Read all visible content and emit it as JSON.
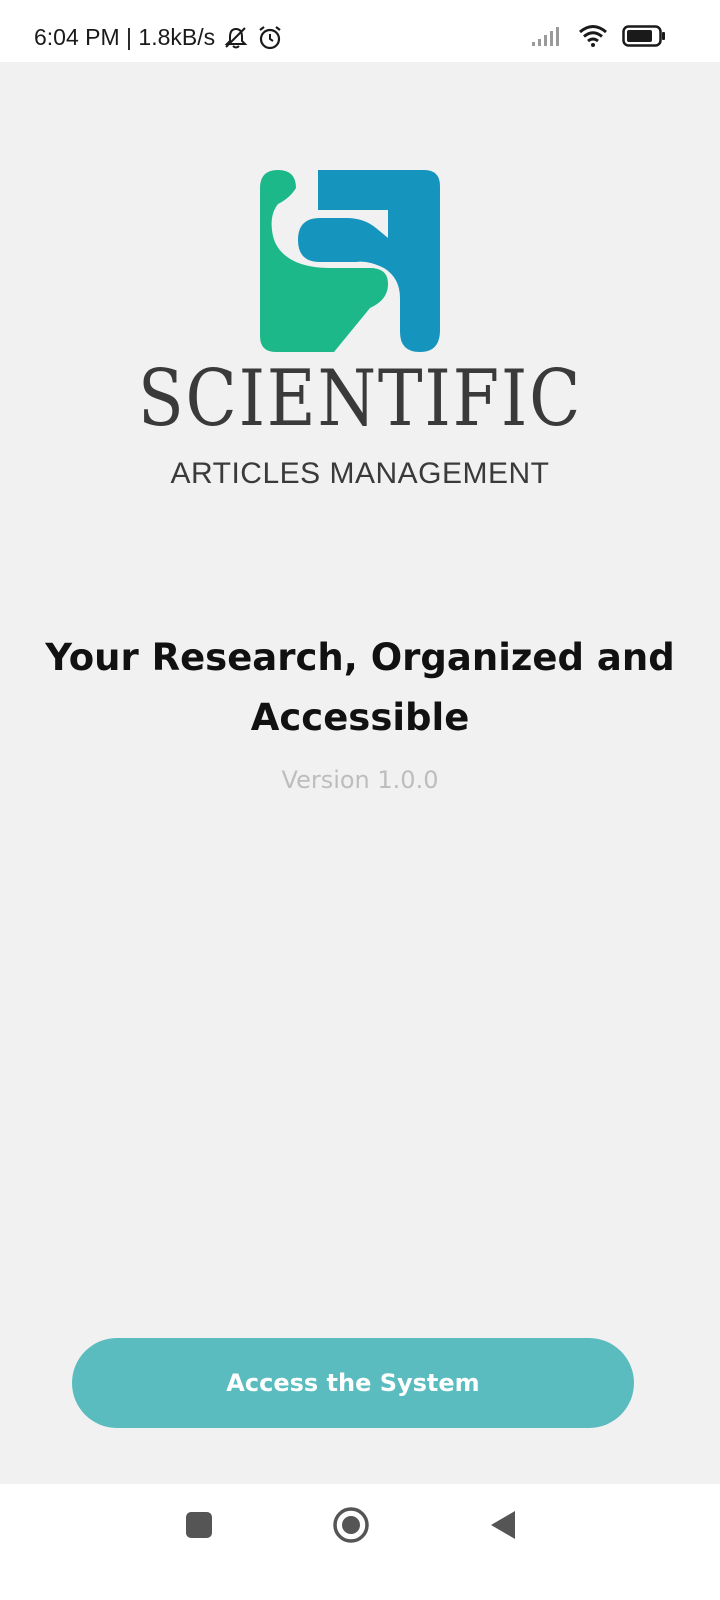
{
  "status_bar": {
    "time": "6:04 PM",
    "separator": " | ",
    "network_speed": "1.8kB/s",
    "icons": [
      "bell-off-icon",
      "alarm-icon",
      "signal-icon",
      "wifi-icon",
      "battery-icon"
    ]
  },
  "logo": {
    "wordmark": "SCIENTIFIC",
    "subtitle": "ARTICLES MANAGEMENT",
    "colors": {
      "green": "#1db88a",
      "blue": "#1594be"
    }
  },
  "tagline": "Your Research, Organized and Accessible",
  "version": "Version 1.0.0",
  "access_button": {
    "label": "Access the System",
    "color": "#5bbcbf"
  },
  "nav_bar": {
    "buttons": [
      "recents-square-icon",
      "home-circle-icon",
      "back-triangle-icon"
    ]
  }
}
